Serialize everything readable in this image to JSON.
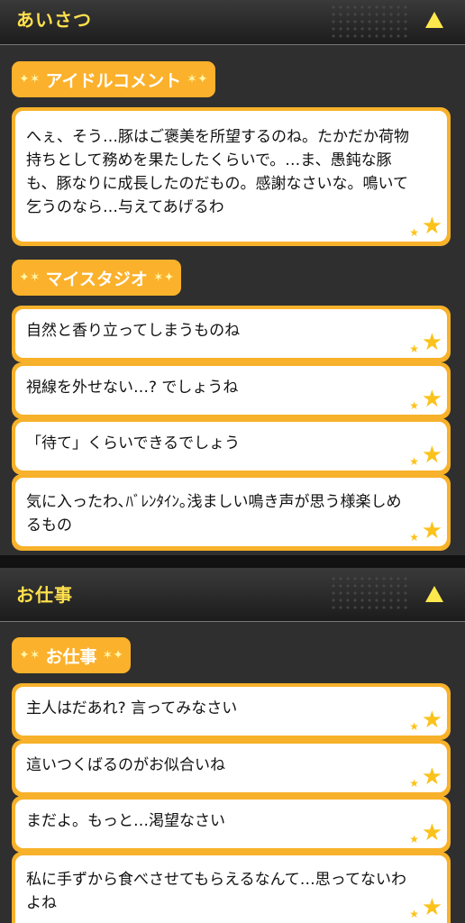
{
  "sections": [
    {
      "title": "あいさつ",
      "groups": [
        {
          "label": "アイドルコメント",
          "items": [
            "へぇ、そう…豚はご褒美を所望するのね。たかだか荷物持ちとして務めを果たしたくらいで。…ま、愚鈍な豚も、豚なりに成長したのだもの。感謝なさいな。鳴いて乞うのなら…与えてあげるわ"
          ]
        },
        {
          "label": "マイスタジオ",
          "items": [
            "自然と香り立ってしまうものね",
            "視線を外せない…? でしょうね",
            "「待て」くらいできるでしょう",
            "気に入ったわ､ﾊﾞﾚﾝﾀｲﾝ｡浅ましい鳴き声が思う様楽しめるもの"
          ]
        }
      ]
    },
    {
      "title": "お仕事",
      "groups": [
        {
          "label": "お仕事",
          "items": [
            "主人はだあれ? 言ってみなさい",
            "這いつくばるのがお似合いね",
            "まだよ。もっと…渇望なさい",
            "私に手ずから食べさせてもらえるなんて…思ってないわよね"
          ]
        }
      ]
    }
  ],
  "colors": {
    "accent": "#fbb12b",
    "title": "#ffe04d",
    "star": "#fbc21c"
  },
  "icons": {
    "collapse": "triangle-up-icon",
    "sparkle": "sparkle-icon",
    "star": "star-icon"
  }
}
